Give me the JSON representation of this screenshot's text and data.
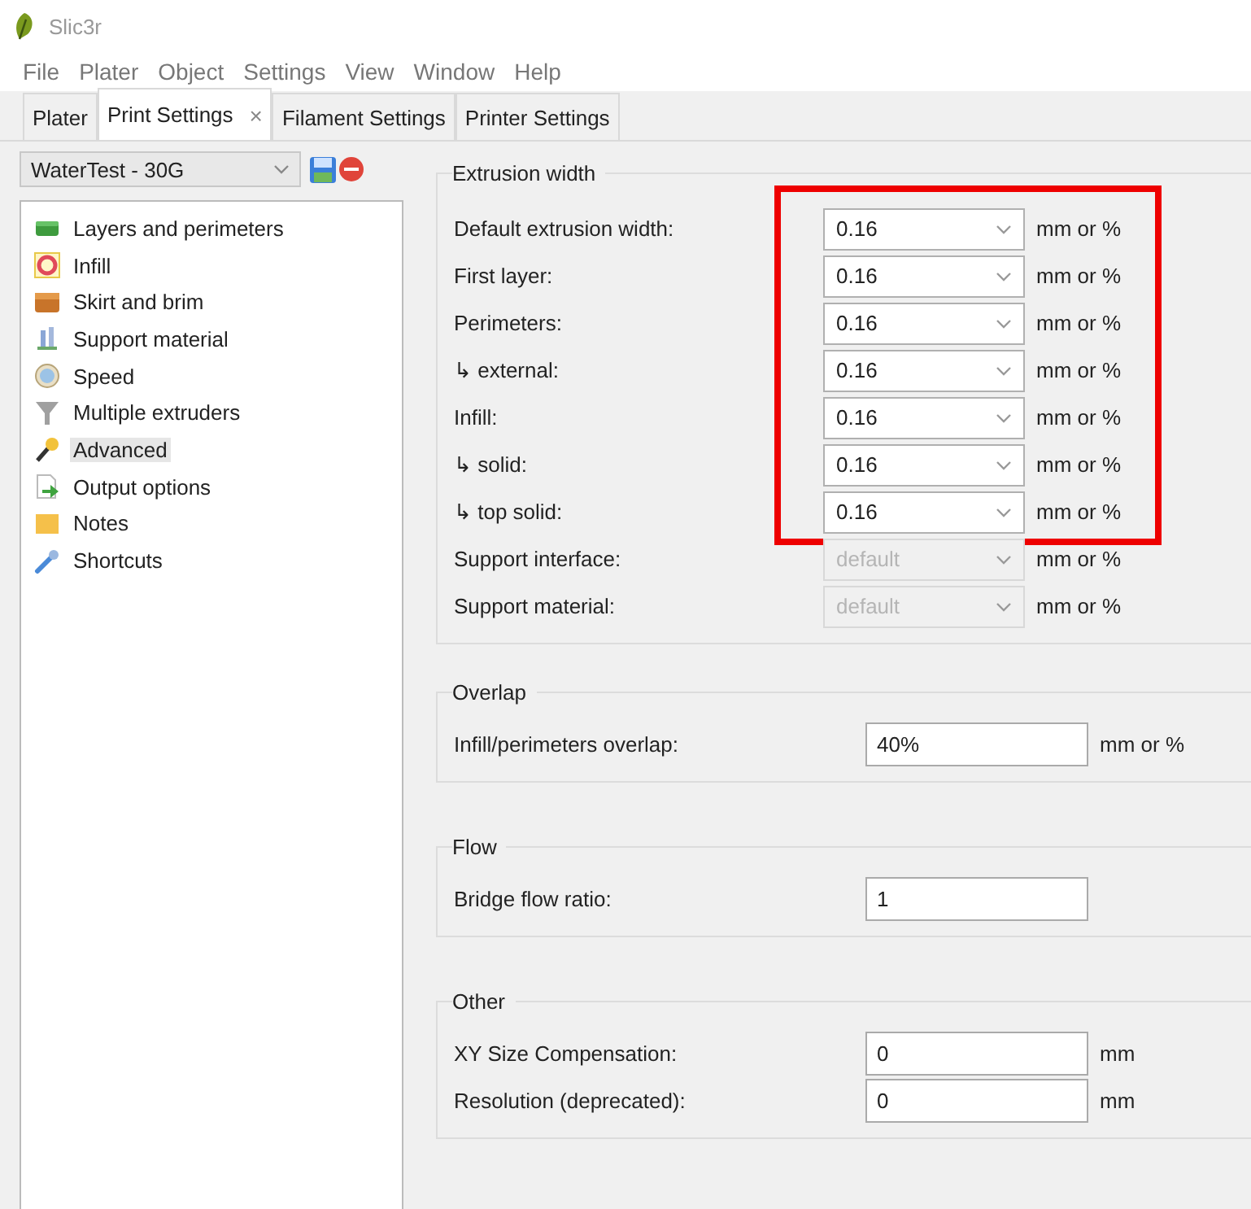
{
  "window": {
    "title": "Slic3r"
  },
  "menu": [
    "File",
    "Plater",
    "Object",
    "Settings",
    "View",
    "Window",
    "Help"
  ],
  "tabs": [
    {
      "label": "Plater",
      "selected": false
    },
    {
      "label": "Print Settings",
      "selected": true,
      "close": "×"
    },
    {
      "label": "Filament Settings",
      "selected": false
    },
    {
      "label": "Printer Settings",
      "selected": false
    }
  ],
  "preset": {
    "value": "WaterTest - 30G"
  },
  "sidebar": {
    "items": [
      {
        "label": "Layers and perimeters",
        "selected": false
      },
      {
        "label": "Infill",
        "selected": false
      },
      {
        "label": "Skirt and brim",
        "selected": false
      },
      {
        "label": "Support material",
        "selected": false
      },
      {
        "label": "Speed",
        "selected": false
      },
      {
        "label": "Multiple extruders",
        "selected": false
      },
      {
        "label": "Advanced",
        "selected": true
      },
      {
        "label": "Output options",
        "selected": false
      },
      {
        "label": "Notes",
        "selected": false
      },
      {
        "label": "Shortcuts",
        "selected": false
      }
    ]
  },
  "groups": [
    {
      "title": "Extrusion width",
      "rows": [
        {
          "label": "Default extrusion width:",
          "kind": "combo",
          "value": "0.16",
          "unit": "mm or %",
          "disabled": false,
          "highlighted": true
        },
        {
          "label": "First layer:",
          "kind": "combo",
          "value": "0.16",
          "unit": "mm or %",
          "disabled": false,
          "highlighted": true
        },
        {
          "label": "Perimeters:",
          "kind": "combo",
          "value": "0.16",
          "unit": "mm or %",
          "disabled": false,
          "highlighted": true
        },
        {
          "label": "↳ external:",
          "kind": "combo",
          "value": "0.16",
          "unit": "mm or %",
          "disabled": false,
          "highlighted": true
        },
        {
          "label": "Infill:",
          "kind": "combo",
          "value": "0.16",
          "unit": "mm or %",
          "disabled": false,
          "highlighted": true
        },
        {
          "label": "↳ solid:",
          "kind": "combo",
          "value": "0.16",
          "unit": "mm or %",
          "disabled": false,
          "highlighted": true
        },
        {
          "label": "↳ top solid:",
          "kind": "combo",
          "value": "0.16",
          "unit": "mm or %",
          "disabled": false,
          "highlighted": true
        },
        {
          "label": "Support interface:",
          "kind": "combo",
          "value": "default",
          "unit": "mm or %",
          "disabled": true,
          "highlighted": false
        },
        {
          "label": "Support material:",
          "kind": "combo",
          "value": "default",
          "unit": "mm or %",
          "disabled": true,
          "highlighted": false
        }
      ]
    },
    {
      "title": "Overlap",
      "rows": [
        {
          "label": "Infill/perimeters overlap:",
          "kind": "text",
          "value": "40%",
          "unit": "mm or %",
          "disabled": false,
          "highlighted": false
        }
      ]
    },
    {
      "title": "Flow",
      "rows": [
        {
          "label": "Bridge flow ratio:",
          "kind": "text",
          "value": "1",
          "disabled": false,
          "highlighted": false
        }
      ]
    },
    {
      "title": "Other",
      "rows": [
        {
          "label": "XY Size Compensation:",
          "kind": "text",
          "value": "0",
          "unit": "mm",
          "disabled": false,
          "highlighted": false
        },
        {
          "label": "Resolution (deprecated):",
          "kind": "text",
          "value": "0",
          "unit": "mm",
          "disabled": false,
          "highlighted": false
        }
      ]
    }
  ]
}
